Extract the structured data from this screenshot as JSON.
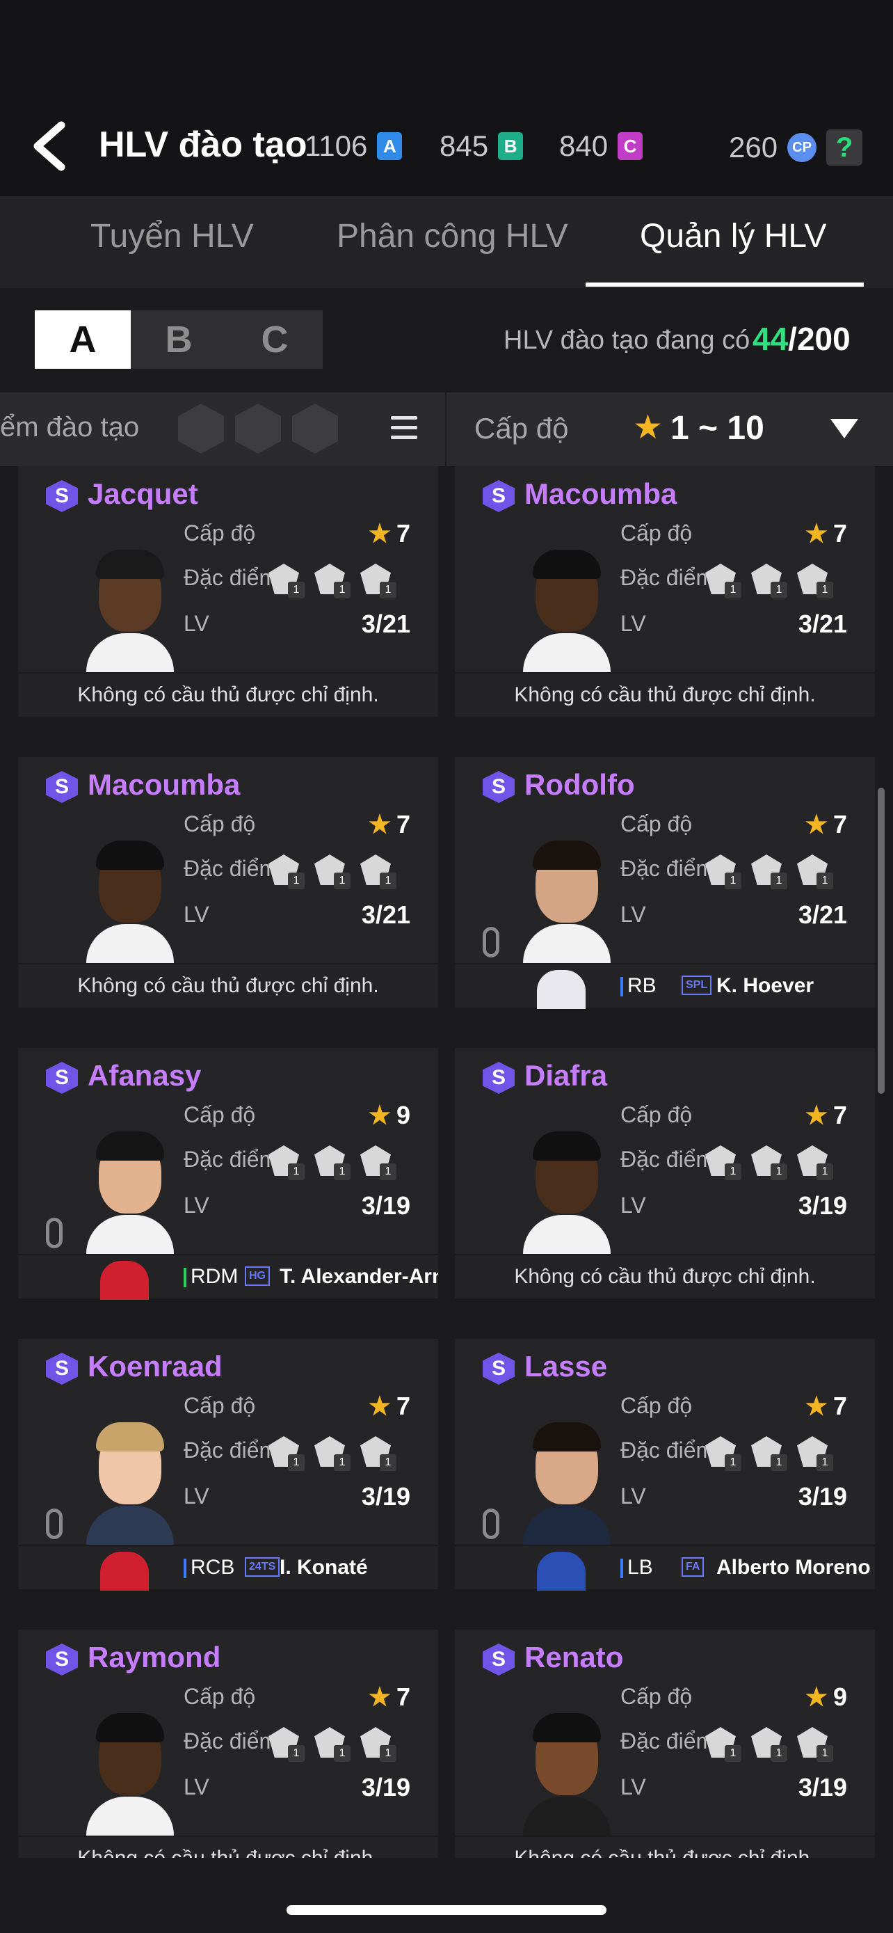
{
  "header": {
    "title": "HLV đào tạo",
    "currencies": [
      {
        "value": "1106",
        "icon": "A",
        "color": "#2f8ae8"
      },
      {
        "value": "845",
        "icon": "B",
        "color": "#1fae8a"
      },
      {
        "value": "840",
        "icon": "C",
        "color": "#c13dc8"
      }
    ],
    "cp_value": "260",
    "cp_icon": "CP",
    "help_icon": "?"
  },
  "tabs": [
    {
      "label": "Tuyển HLV",
      "active": false
    },
    {
      "label": "Phân công HLV",
      "active": false
    },
    {
      "label": "Quản lý HLV",
      "active": true
    }
  ],
  "groups": [
    "A",
    "B",
    "C"
  ],
  "count": {
    "label": "HLV đào tạo đang có",
    "current": "44",
    "max": "/200"
  },
  "filter": {
    "left_label": "ểm đào tạo",
    "right_label": "Cấp độ",
    "range": "1 ~ 10"
  },
  "labels": {
    "level": "Cấp độ",
    "trait": "Đặc điểm",
    "trait_alt": "Đặc điểm",
    "lv": "LV",
    "no_player": "Không có cầu thủ được chỉ định."
  },
  "cards": [
    {
      "name": "Jacquet",
      "stars": "7",
      "lv": "3/21",
      "skin": "#5b3a26",
      "hair": "#1a1a1a",
      "shirt": "#f2f2f2",
      "player": null
    },
    {
      "name": "Macoumba",
      "stars": "7",
      "lv": "3/21",
      "skin": "#4a2e1c",
      "hair": "#111111",
      "shirt": "#f2f2f2",
      "player": null
    },
    {
      "name": "Macoumba",
      "stars": "7",
      "lv": "3/21",
      "skin": "#4a2e1c",
      "hair": "#111111",
      "shirt": "#f2f2f2",
      "player": null
    },
    {
      "name": "Rodolfo",
      "stars": "7",
      "lv": "3/21",
      "skin": "#d4a584",
      "hair": "#1a120c",
      "shirt": "#f2f2f2",
      "player": {
        "pos": "RB",
        "club": "SPL",
        "name": "K. Hoever",
        "bar": "#3a7bff",
        "kit": "#e8e8ee"
      }
    },
    {
      "name": "Afanasy",
      "stars": "9",
      "lv": "3/19",
      "skin": "#e2b18d",
      "hair": "#151515",
      "shirt": "#f2f2f2",
      "player": {
        "pos": "RDM",
        "club": "HG",
        "name": "T. Alexander-Arnold",
        "bar": "#2fcf5a",
        "kit": "#d02030"
      }
    },
    {
      "name": "Diafra",
      "stars": "7",
      "lv": "3/19",
      "skin": "#4a2e1c",
      "hair": "#111111",
      "shirt": "#f2f2f2",
      "player": null
    },
    {
      "name": "Koenraad",
      "stars": "7",
      "lv": "3/19",
      "skin": "#f0c6a8",
      "hair": "#c9a46a",
      "shirt": "#2e3b55",
      "player": {
        "pos": "RCB",
        "club": "24TS",
        "name": "I. Konaté",
        "bar": "#3a7bff",
        "kit": "#d02030"
      }
    },
    {
      "name": "Lasse",
      "stars": "7",
      "lv": "3/19",
      "skin": "#d9a889",
      "hair": "#1a120c",
      "shirt": "#1e2a40",
      "player": {
        "pos": "LB",
        "club": "FA",
        "name": "Alberto Moreno",
        "bar": "#3a7bff",
        "kit": "#2a4fb5"
      }
    },
    {
      "name": "Raymond",
      "stars": "7",
      "lv": "3/19",
      "skin": "#4a2e1c",
      "hair": "#111111",
      "shirt": "#f2f2f2",
      "player": null
    },
    {
      "name": "Renato",
      "stars": "9",
      "lv": "3/19",
      "skin": "#7a4a2c",
      "hair": "#111111",
      "shirt": "#1e1e1e",
      "player": null
    }
  ]
}
